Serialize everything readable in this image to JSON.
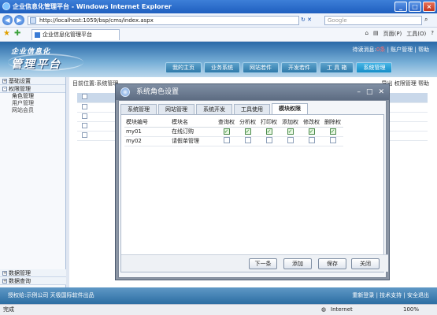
{
  "window": {
    "title": "企业信息化管理平台 - Windows Internet Explorer"
  },
  "address": {
    "url": "http://localhost:1059/bsp/cms/index.aspx",
    "search_placeholder": "Google"
  },
  "favbar": {
    "tab_label": "企业信息化管理平台",
    "tools": [
      "页面(P)",
      "工具(O)",
      "?"
    ]
  },
  "header": {
    "logo_top": "企业信息化",
    "logo_main": "管理平台",
    "notice_prefix": "待读消息:",
    "notice_count": "0条",
    "links": "| 账户管理 | 帮助",
    "nav": [
      "我的主页",
      "业务系统",
      "网站若件",
      "开发若件",
      "工 具 箱",
      "系统管理"
    ]
  },
  "sidebar": {
    "sections": [
      "基础设置",
      "权限管理"
    ],
    "items": [
      "角色管理",
      "用户管理",
      "网站会员"
    ],
    "bottom": [
      "数据管理",
      "数据查询"
    ]
  },
  "main": {
    "breadcrumb": "目前位置:系统管理",
    "actions": "导出  权限管理  帮助"
  },
  "modal": {
    "title": "系统角色设置",
    "tabs": [
      "系统管理",
      "网站管理",
      "系统开发",
      "工具使用",
      "模块权限"
    ],
    "table": {
      "headers": [
        "模块编号",
        "模块名",
        "查询权",
        "分析权",
        "打印权",
        "添加权",
        "修改权",
        "删除权"
      ],
      "rows": [
        {
          "id": "my01",
          "name": "在线订购",
          "perms": [
            true,
            true,
            true,
            true,
            true,
            true
          ]
        },
        {
          "id": "my02",
          "name": "请假单管理",
          "perms": [
            false,
            false,
            false,
            false,
            false,
            false
          ]
        }
      ]
    },
    "buttons": [
      "下一条",
      "添加",
      "保存",
      "关闭"
    ]
  },
  "footer": {
    "left": "授权给:示例公司  天极国际软件出品",
    "right": "重新登录 | 技术支持 | 安全退出"
  },
  "status": {
    "left": "完成",
    "zone": "Internet",
    "zoom": "100%"
  }
}
